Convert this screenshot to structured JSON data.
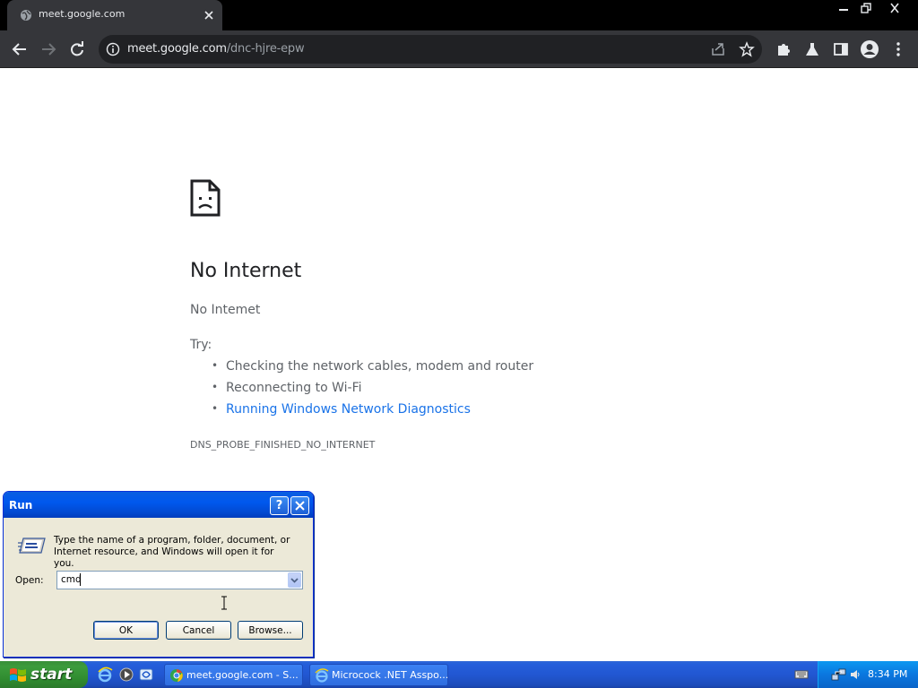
{
  "browser": {
    "tab": {
      "title": "meet.google.com"
    },
    "address_bar": {
      "url_host": "meet.google.com",
      "url_path": "/dnc-hjre-epw"
    },
    "window_controls": [
      "minimize",
      "restore",
      "close"
    ]
  },
  "error_page": {
    "title": "No Internet",
    "subtitle": "No Intemet",
    "try_label": "Try:",
    "suggestions": [
      "Checking the network cables, modem and router",
      "Reconnecting to Wi-Fi",
      "Running Windows Network Diagnostics"
    ],
    "error_code": "DNS_PROBE_FINISHED_NO_INTERNET"
  },
  "run_dialog": {
    "title": "Run",
    "help_label": "?",
    "description": "Type the name of a program, folder, document, or Internet resource, and Windows will open it for you.",
    "open_label": "Open:",
    "open_value": "cmd",
    "ok_label": "OK",
    "cancel_label": "Cancel",
    "browse_label": "Browse..."
  },
  "taskbar": {
    "start_label": "start",
    "tasks": [
      {
        "label": "meet.google.com - S...",
        "icon": "chrome-icon"
      },
      {
        "label": "Microcock .NET Asspo...",
        "icon": "ie-icon"
      }
    ],
    "clock": "8:34 PM"
  }
}
